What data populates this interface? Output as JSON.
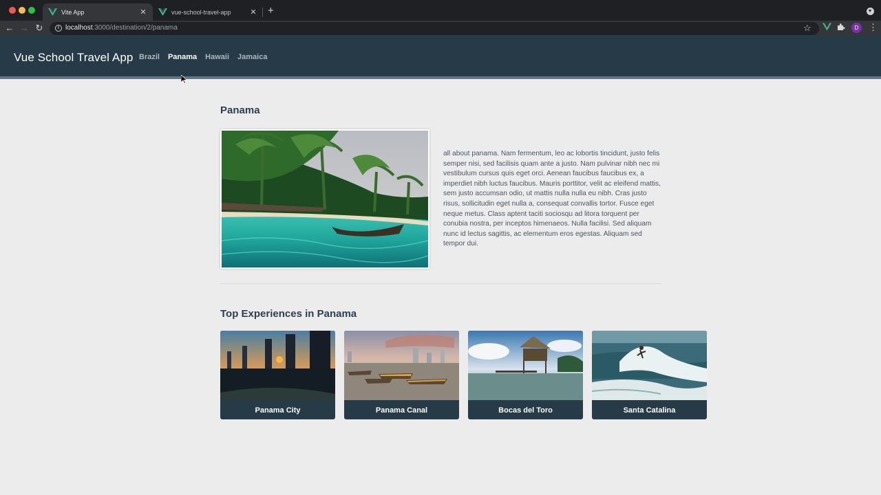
{
  "browser": {
    "tabs": [
      {
        "title": "Vite App",
        "close": "✕"
      },
      {
        "title": "vue-school-travel-app",
        "close": "✕"
      }
    ],
    "new_tab": "+",
    "url_host": "localhost",
    "url_path": ":3000/destination/2/panama",
    "profile_initial": "D"
  },
  "header": {
    "brand": "Vue School Travel App",
    "links": [
      "Brazil",
      "Panama",
      "Hawaii",
      "Jamaica"
    ],
    "active_link": "Panama"
  },
  "destination": {
    "title": "Panama",
    "description": "all about panama. Nam fermentum, leo ac lobortis tincidunt, justo felis semper nisi, sed facilisis quam ante a justo. Nam pulvinar nibh nec mi vestibulum cursus quis eget orci. Aenean faucibus faucibus ex, a imperdiet nibh luctus faucibus. Mauris porttitor, velit ac eleifend mattis, sem justo accumsan odio, ut mattis nulla nulla eu nibh. Cras justo risus, sollicitudin eget nulla a, consequat convallis tortor. Fusce eget neque metus. Class aptent taciti sociosqu ad litora torquent per conubia nostra, per inceptos himenaeos. Nulla facilisi. Sed aliquam nunc id lectus sagittis, ac elementum eros egestas. Aliquam sed tempor dui."
  },
  "experiences": {
    "title": "Top Experiences in Panama",
    "items": [
      "Panama City",
      "Panama Canal",
      "Bocas del Toro",
      "Santa Catalina"
    ]
  },
  "colors": {
    "header_bg": "#263a48",
    "page_bg": "#ececec",
    "card_label_bg": "#263a48",
    "vue_green": "#42b883"
  }
}
